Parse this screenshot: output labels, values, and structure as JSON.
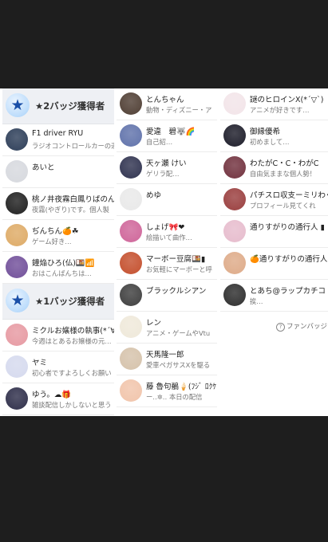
{
  "col1": {
    "header2": "★2バッジ獲得者",
    "rows2": [
      {
        "name": "F1 driver RYU",
        "desc": "ラジオコントロールカーの運",
        "av": "#3a4a63"
      },
      {
        "name": "あいと",
        "desc": "",
        "av": "#d9dbe0"
      },
      {
        "name": "桃ノ井夜霧白鳳りばのんと。",
        "desc": "夜霧(やぎり)です。個人製",
        "av": "#2d2d2d"
      },
      {
        "name": "ぢんちん🍊☘",
        "desc": "ゲーム好き…",
        "av": "#e0b070"
      },
      {
        "name": "鐘焔ひろ(仏)🍱📶",
        "desc": "おはこんばんちは…",
        "av": "#7a5aa0"
      }
    ],
    "header1": "★1バッジ獲得者",
    "rows1": [
      {
        "name": "ミクルお嬢様の執事(*´∀`*",
        "desc": "今週はとあるお嬢様の元…",
        "av": "#e8a0a8"
      },
      {
        "name": "ヤミ",
        "desc": "初心者ですよろしくお願い",
        "av": "#d8dcef"
      },
      {
        "name": "ゆう。☁🎁",
        "desc": "雑談配信しかしないと思う",
        "av": "#3b3b55"
      }
    ]
  },
  "col2": {
    "rows": [
      {
        "name": "とんちゃん",
        "desc": "動物・ディズニー・ア",
        "av": "#5a4a40"
      },
      {
        "name": "愛違　碧🐺🌈",
        "desc": "自己紹…",
        "av": "#6a7bb0"
      },
      {
        "name": "天ヶ瀬 けい",
        "desc": "ゲリラ配…",
        "av": "#3c3f5a"
      },
      {
        "name": "めゆ",
        "desc": "",
        "av": "#eaeaea"
      },
      {
        "name": "しょげ🎀❤",
        "desc": "絵描いて曲作…",
        "av": "#d26fa0"
      },
      {
        "name": "マーボー豆腐🍱▮",
        "desc": "お気軽にマーボーと呼",
        "av": "#c85a3a"
      },
      {
        "name": "ブラックルシアン",
        "desc": "",
        "av": "#4a4a4a"
      },
      {
        "name": "レン",
        "desc": "アニメ・ゲームやVtu",
        "av": "#f0eadc"
      },
      {
        "name": "天馬隆一郎",
        "desc": "愛車ペガサスXを駆る",
        "av": "#d8c6b0"
      },
      {
        "name": "藤 魯句鶺🍦(ﾌｼﾞ ﾛｸｹ",
        "desc": "ー‥✲‥ 本日の配信",
        "av": "#f2c8b0"
      }
    ]
  },
  "col3": {
    "rows": [
      {
        "name": "謎のヒロインX(*´▽`)",
        "desc": "アニメが好きです…",
        "av": "#f3e6ea"
      },
      {
        "name": "御縁優希",
        "desc": "初めまして…",
        "av": "#2a2a36"
      },
      {
        "name": "わたがC・C・わがC",
        "desc": "自由気ままな個人勢！",
        "av": "#7a3e4a"
      },
      {
        "name": "パチスロ収支ーミリわくく",
        "desc": "プロフィール見てくれ",
        "av": "#a04a4a"
      },
      {
        "name": "通りすがりの通行人 ▮",
        "desc": "",
        "av": "#e8c0d0"
      },
      {
        "name": "🍊通りすがりの通行人",
        "desc": "",
        "av": "#e0b090"
      },
      {
        "name": "とあち@ラップカチコ",
        "desc": "挨…",
        "av": "#3a3a3a"
      }
    ],
    "footer": "ファンバッジ"
  },
  "colors": {
    "background": "#1e1e1e",
    "panel": "#ffffff",
    "header": "#eef0f4"
  }
}
